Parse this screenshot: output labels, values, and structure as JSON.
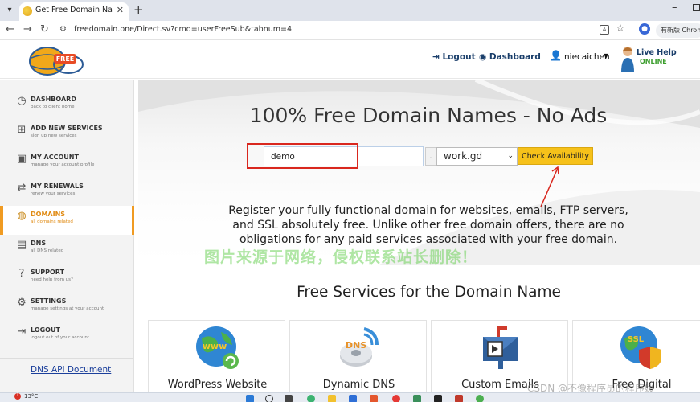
{
  "browser": {
    "tab_title": "Get Free Domain Names - R",
    "url": "freedomain.one/Direct.sv?cmd=userFreeSub&tabnum=4",
    "new_version_label": "有新版 Chrome"
  },
  "header": {
    "logo_text": "FREE",
    "logout_label": "Logout",
    "dashboard_label": "Dashboard",
    "username": "niecaichen",
    "live_help_title": "Live Help",
    "live_help_status": "ONLINE"
  },
  "sidebar": {
    "items": [
      {
        "title": "DASHBOARD",
        "subtitle": "back to client home",
        "icon": "dashboard-icon",
        "active": false
      },
      {
        "title": "ADD NEW SERVICES",
        "subtitle": "sign up new services",
        "icon": "plus-icon",
        "active": false
      },
      {
        "title": "MY ACCOUNT",
        "subtitle": "manage your account profile",
        "icon": "account-icon",
        "active": false
      },
      {
        "title": "MY RENEWALS",
        "subtitle": "renew your services",
        "icon": "renew-icon",
        "active": false
      },
      {
        "title": "DOMAINS",
        "subtitle": "all domains related",
        "icon": "globe-icon",
        "active": true
      },
      {
        "title": "DNS",
        "subtitle": "all DNS related",
        "icon": "dns-icon",
        "active": false
      },
      {
        "title": "SUPPORT",
        "subtitle": "need help from us?",
        "icon": "support-icon",
        "active": false
      },
      {
        "title": "SETTINGS",
        "subtitle": "manage settings at your account",
        "icon": "settings-icon",
        "active": false
      },
      {
        "title": "LOGOUT",
        "subtitle": "logout out of your account",
        "icon": "logout-icon",
        "active": false
      }
    ],
    "dns_api_label": "DNS API Document"
  },
  "hero": {
    "title": "100% Free Domain Names - No Ads",
    "search_value": "demo",
    "dot_separator": ".",
    "tld_selected": "work.gd",
    "check_button_label": "Check Availability",
    "description": "Register your fully functional domain for websites, emails, FTP servers, and SSL absolutely free. Unlike other free domain offers, there are no obligations for any paid services associated with your free domain."
  },
  "overlay": {
    "watermark": "图片来源于网络，侵权联系站长删除！",
    "csdn_watermark": "CSDN @不像程序员的程序媛"
  },
  "services": {
    "title": "Free Services for the Domain Name",
    "cards": [
      {
        "label": "WordPress Website",
        "icon": "www-globe-icon",
        "icon_text": "www"
      },
      {
        "label": "Dynamic DNS",
        "icon": "dns-disc-icon",
        "icon_text": "DNS"
      },
      {
        "label": "Custom Emails",
        "icon": "mailbox-icon"
      },
      {
        "label": "Free Digital",
        "icon": "ssl-shield-icon",
        "icon_text": "SSL"
      }
    ]
  },
  "taskbar": {
    "temperature": "13°C",
    "badge_count": "1"
  },
  "colors": {
    "accent_orange": "#f09b22",
    "button_yellow": "#f6c11a",
    "brand_navy": "#1b3f6b",
    "highlight_red": "#d9271e"
  }
}
